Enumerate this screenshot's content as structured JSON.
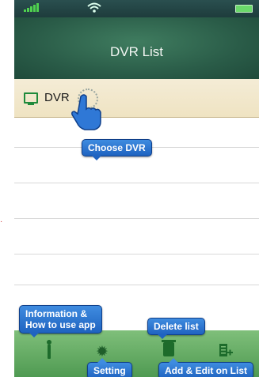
{
  "header": {
    "title": "DVR List"
  },
  "list": {
    "items": [
      {
        "label": "DVR"
      }
    ]
  },
  "callouts": {
    "choose": "Choose DVR",
    "info_line1": "Information &",
    "info_line2": "How to use app",
    "delete": "Delete list",
    "setting": "Setting",
    "add": "Add & Edit on List"
  },
  "toolbar": {
    "info_icon": "info-icon",
    "setting_icon": "gear-icon",
    "delete_icon": "trash-icon",
    "add_icon": "add-list-icon"
  },
  "colors": {
    "status_bg": "#1e3c3c",
    "title_bg": "#2a5c48",
    "selected_row": "#efe3c2",
    "toolbar": "#4f9a52",
    "callout": "#1f63c0"
  }
}
